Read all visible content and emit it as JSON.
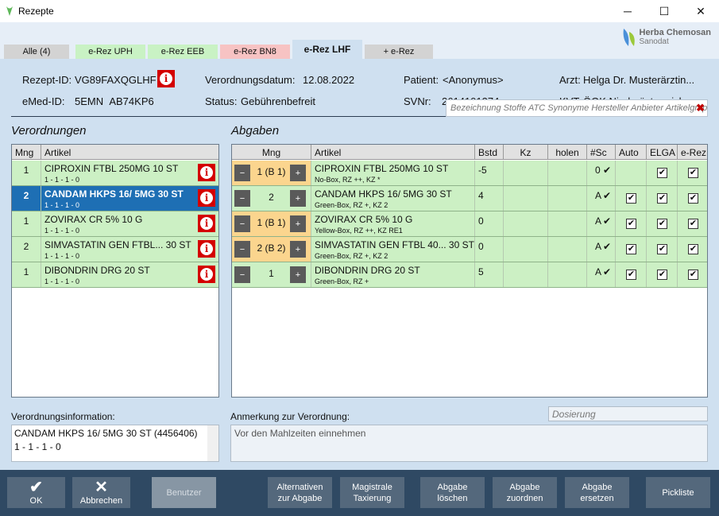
{
  "window": {
    "title": "Rezepte",
    "minimize": "─",
    "maximize": "☐",
    "close": "✕"
  },
  "colors": {
    "selected_row": "#1e6fb4",
    "green_row": "#ccf0c4",
    "warn_cell": "#fbd58e",
    "info_red": "#d40000"
  },
  "tabs": [
    {
      "label": "Alle (4)"
    },
    {
      "label": "e-Rez UPH"
    },
    {
      "label": "e-Rez EEB"
    },
    {
      "label": "e-Rez BN8"
    },
    {
      "label": "e-Rez LHF"
    },
    {
      "label": "+ e-Rez"
    }
  ],
  "logo": {
    "name": "Herba Chemosan",
    "sub": "Sanodat"
  },
  "header": {
    "rezept_id_label": "Rezept-ID:",
    "rezept_id": "VG89FAXQGLHF",
    "emed_id_label": "eMed-ID:",
    "emed_id": "5EMN  AB74KP6",
    "datum_label": "Verordnungsdatum:",
    "datum": "12.08.2022",
    "status_label": "Status:",
    "status": "Gebührenbefreit",
    "patient_label": "Patient:",
    "patient": "<Anonymus>",
    "svnr_label": "SVNr:",
    "svnr": "2614101374",
    "arzt_label": "Arzt:",
    "arzt": "Helga Dr. Musterärztin...",
    "kvt_label": "KVT:",
    "kvt": "ÖGK Niederösterreich",
    "info_glyph": "i"
  },
  "verordnungen": {
    "title": "Verordnungen",
    "columns": [
      "Mng",
      "Artikel"
    ],
    "rows": [
      {
        "mng": "1",
        "artikel": "CIPROXIN FTBL 250MG 10  ST",
        "dosierung": "1 - 1 - 1 - 0"
      },
      {
        "mng": "2",
        "artikel": "CANDAM HKPS 16/ 5MG 30  ST",
        "dosierung": "1 - 1 - 1 - 0"
      },
      {
        "mng": "1",
        "artikel": "ZOVIRAX CR 5% 10  G",
        "dosierung": "1 - 1 - 1 - 0"
      },
      {
        "mng": "2",
        "artikel": "SIMVASTATIN GEN FTBL... 30  ST",
        "dosierung": "1 - 1 - 1 - 0"
      },
      {
        "mng": "1",
        "artikel": "DIBONDRIN DRG 20  ST",
        "dosierung": "1 - 1 - 1 - 0"
      }
    ]
  },
  "abgaben": {
    "title": "Abgaben",
    "search_placeholder": "Bezeichnung Stoffe ATC Synonyme Hersteller Anbieter Artikelgruppe",
    "search_clear": "✖",
    "columns": [
      "Mng",
      "Artikel",
      "Bstd",
      "Kz",
      "holen",
      "#Sc",
      "Auto",
      "ELGA",
      "e-Rez"
    ],
    "minus": "−",
    "plus": "+",
    "check": "✔",
    "rows": [
      {
        "mng": "1 (B 1)",
        "artikel": "CIPROXIN FTBL 250MG 10  ST",
        "info": "No-Box, RZ ++, KZ *",
        "bstd": "-5",
        "sc": "0",
        "auto": false,
        "elga": true,
        "erez": true,
        "warn": true
      },
      {
        "mng": "2",
        "artikel": "CANDAM HKPS 16/ 5MG 30  ST",
        "info": "Green-Box, RZ +, KZ 2",
        "bstd": "4",
        "sc": "A",
        "auto": true,
        "elga": true,
        "erez": true,
        "warn": false
      },
      {
        "mng": "1 (B 1)",
        "artikel": "ZOVIRAX CR 5% 10  G",
        "info": "Yellow-Box, RZ ++, KZ RE1",
        "bstd": "0",
        "sc": "A",
        "auto": true,
        "elga": true,
        "erez": true,
        "warn": true
      },
      {
        "mng": "2 (B 2)",
        "artikel": "SIMVASTATIN GEN FTBL 40... 30  ST",
        "info": "Green-Box, RZ +, KZ 2",
        "bstd": "0",
        "sc": "A",
        "auto": true,
        "elga": true,
        "erez": true,
        "warn": true
      },
      {
        "mng": "1",
        "artikel": "DIBONDRIN DRG 20  ST",
        "info": "Green-Box, RZ +",
        "bstd": "5",
        "sc": "A",
        "auto": true,
        "elga": true,
        "erez": true,
        "warn": false
      }
    ]
  },
  "verordnungsinfo": {
    "label": "Verordnungsinformation:",
    "line1": "CANDAM HKPS 16/ 5MG 30  ST (4456406)",
    "line2": "1 - 1 - 1 - 0"
  },
  "anmerkung": {
    "label": "Anmerkung zur Verordnung:",
    "text": "Vor den Mahlzeiten einnehmen",
    "dosierung_placeholder": "Dosierung"
  },
  "buttons": {
    "ok": "OK",
    "abbrechen": "Abbrechen",
    "benutzer": "Benutzer",
    "alternativen_1": "Alternativen",
    "alternativen_2": "zur Abgabe",
    "magistrale_1": "Magistrale",
    "magistrale_2": "Taxierung",
    "loeschen_1": "Abgabe",
    "loeschen_2": "löschen",
    "zuordnen_1": "Abgabe",
    "zuordnen_2": "zuordnen",
    "ersetzen_1": "Abgabe",
    "ersetzen_2": "ersetzen",
    "pickliste": "Pickliste"
  }
}
